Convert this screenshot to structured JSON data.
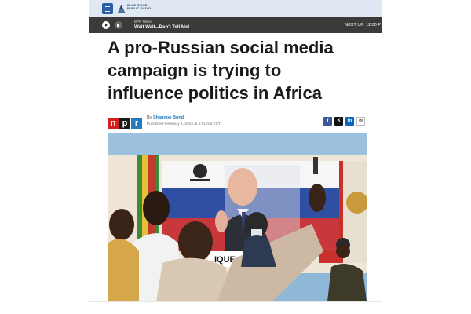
{
  "header": {
    "menu_icon": "hamburger-menu-icon",
    "logo_text": "BLUE RIDGE PUBLIC RADIO"
  },
  "player": {
    "station": "BPR News",
    "show": "Wait Wait...Don't Tell Me!",
    "next_up": "NEXT UP: 12:00 P"
  },
  "article": {
    "headline": "A pro-Russian social media campaign is trying to influence politics in Africa",
    "source_logo": "npr",
    "byline_prefix": "By",
    "author": "Shannon Bond",
    "published": "Published February 1, 2023 at 5:01 AM EST",
    "share": [
      "facebook-icon",
      "x-icon",
      "linkedin-icon",
      "email-icon"
    ],
    "photo_banner_text": "IQUE SERA L"
  },
  "colors": {
    "topbar_bg": "#dfe8f3",
    "player_bg": "#3a3a3a",
    "npr_red": "#d62021",
    "npr_blue": "#237bbd",
    "facebook": "#3b5998",
    "linkedin": "#0a66c2"
  }
}
